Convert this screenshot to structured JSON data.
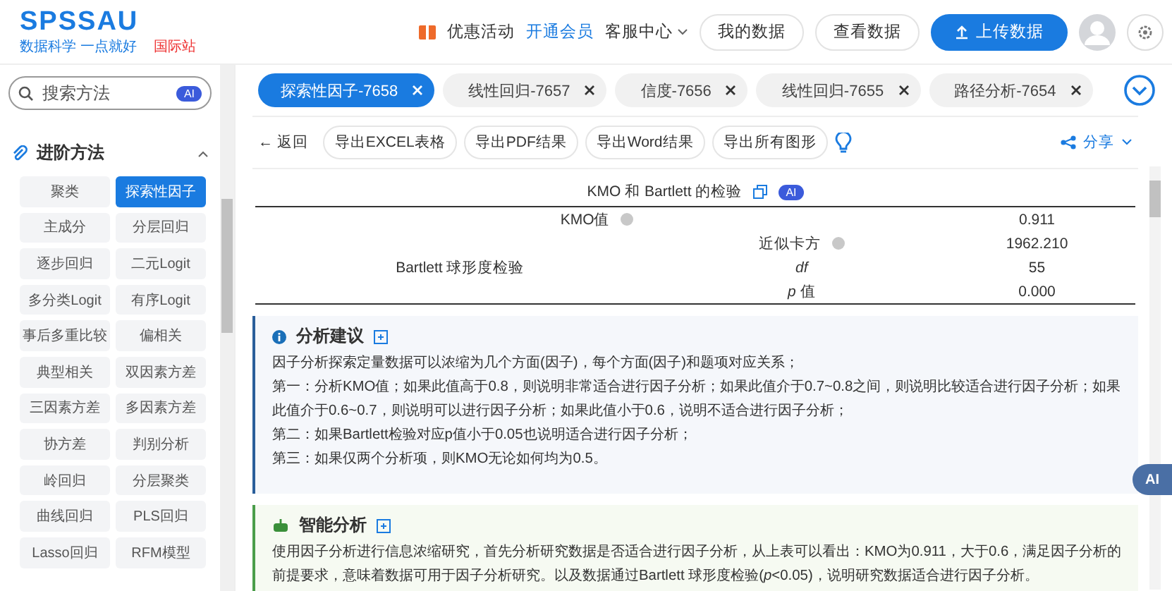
{
  "header": {
    "logo": "SPSSAU",
    "slogan": "数据科学 一点就好",
    "site_badge": "国际站",
    "links": [
      {
        "label": "优惠活动",
        "kind": "promo"
      },
      {
        "label": "开通会员",
        "kind": "vip"
      },
      {
        "label": "客服中心",
        "kind": "menu"
      }
    ],
    "buttons": [
      {
        "label": "我的数据",
        "kind": "outline"
      },
      {
        "label": "查看数据",
        "kind": "outline"
      },
      {
        "label": "上传数据",
        "kind": "primary"
      }
    ]
  },
  "sidebar": {
    "search": {
      "placeholder": "搜索方法",
      "badge": "AI"
    },
    "section": {
      "title": "进阶方法",
      "expanded": true
    },
    "items": [
      {
        "label": "聚类",
        "selected": false
      },
      {
        "label": "探索性因子",
        "selected": true
      },
      {
        "label": "主成分",
        "selected": false
      },
      {
        "label": "分层回归",
        "selected": false
      },
      {
        "label": "逐步回归",
        "selected": false
      },
      {
        "label": "二元Logit",
        "selected": false
      },
      {
        "label": "多分类Logit",
        "selected": false
      },
      {
        "label": "有序Logit",
        "selected": false
      },
      {
        "label": "事后多重比较",
        "selected": false
      },
      {
        "label": "偏相关",
        "selected": false
      },
      {
        "label": "典型相关",
        "selected": false
      },
      {
        "label": "双因素方差",
        "selected": false
      },
      {
        "label": "三因素方差",
        "selected": false
      },
      {
        "label": "多因素方差",
        "selected": false
      },
      {
        "label": "协方差",
        "selected": false
      },
      {
        "label": "判别分析",
        "selected": false
      },
      {
        "label": "岭回归",
        "selected": false
      },
      {
        "label": "分层聚类",
        "selected": false
      },
      {
        "label": "曲线回归",
        "selected": false
      },
      {
        "label": "PLS回归",
        "selected": false
      },
      {
        "label": "Lasso回归",
        "selected": false
      },
      {
        "label": "RFM模型",
        "selected": false
      }
    ]
  },
  "tabs": [
    {
      "label": "探索性因子-7658",
      "selected": true
    },
    {
      "label": "线性回归-7657",
      "selected": false
    },
    {
      "label": "信度-7656",
      "selected": false
    },
    {
      "label": "线性回归-7655",
      "selected": false
    },
    {
      "label": "路径分析-7654",
      "selected": false
    }
  ],
  "toolbar": {
    "back": "← 返回",
    "buttons": [
      "导出EXCEL表格",
      "导出PDF结果",
      "导出Word结果",
      "导出所有图形"
    ],
    "share": "分享"
  },
  "table": {
    "title": "KMO 和 Bartlett 的检验",
    "badge": "AI",
    "kmo": {
      "label": "KMO值",
      "value": "0.911"
    },
    "bartlett": {
      "label": "Bartlett 球形度检验",
      "rows": [
        {
          "label": "近似卡方",
          "help": true,
          "italic": false,
          "value": "1962.210"
        },
        {
          "label": "df",
          "help": false,
          "italic": true,
          "value": "55"
        },
        {
          "label": "*p* 值",
          "help": false,
          "italic": false,
          "value": "0.000"
        }
      ]
    }
  },
  "advice": {
    "title": "分析建议",
    "paragraphs": [
      "因子分析探索定量数据可以浓缩为几个方面(因子)，每个方面(因子)和题项对应关系；",
      "第一：分析KMO值；如果此值高于0.8，则说明非常适合进行因子分析；如果此值介于0.7~0.8之间，则说明比较适合进行因子分析；如果此值介于0.6~0.7，则说明可以进行因子分析；如果此值小于0.6，说明不适合进行因子分析；",
      "第二：如果Bartlett检验对应p值小于0.05也说明适合进行因子分析；",
      "第三：如果仅两个分析项，则KMO无论如何均为0.5。"
    ]
  },
  "smart": {
    "title": "智能分析",
    "paragraphs": [
      "使用因子分析进行信息浓缩研究，首先分析研究数据是否适合进行因子分析，从上表可以看出：KMO为0.911，大于0.6，满足因子分析的前提要求，意味着数据可用于因子分析研究。以及数据通过Bartlett 球形度检验(*p*<0.05)，说明研究数据适合进行因子分析。"
    ]
  },
  "ai_button": "AI"
}
